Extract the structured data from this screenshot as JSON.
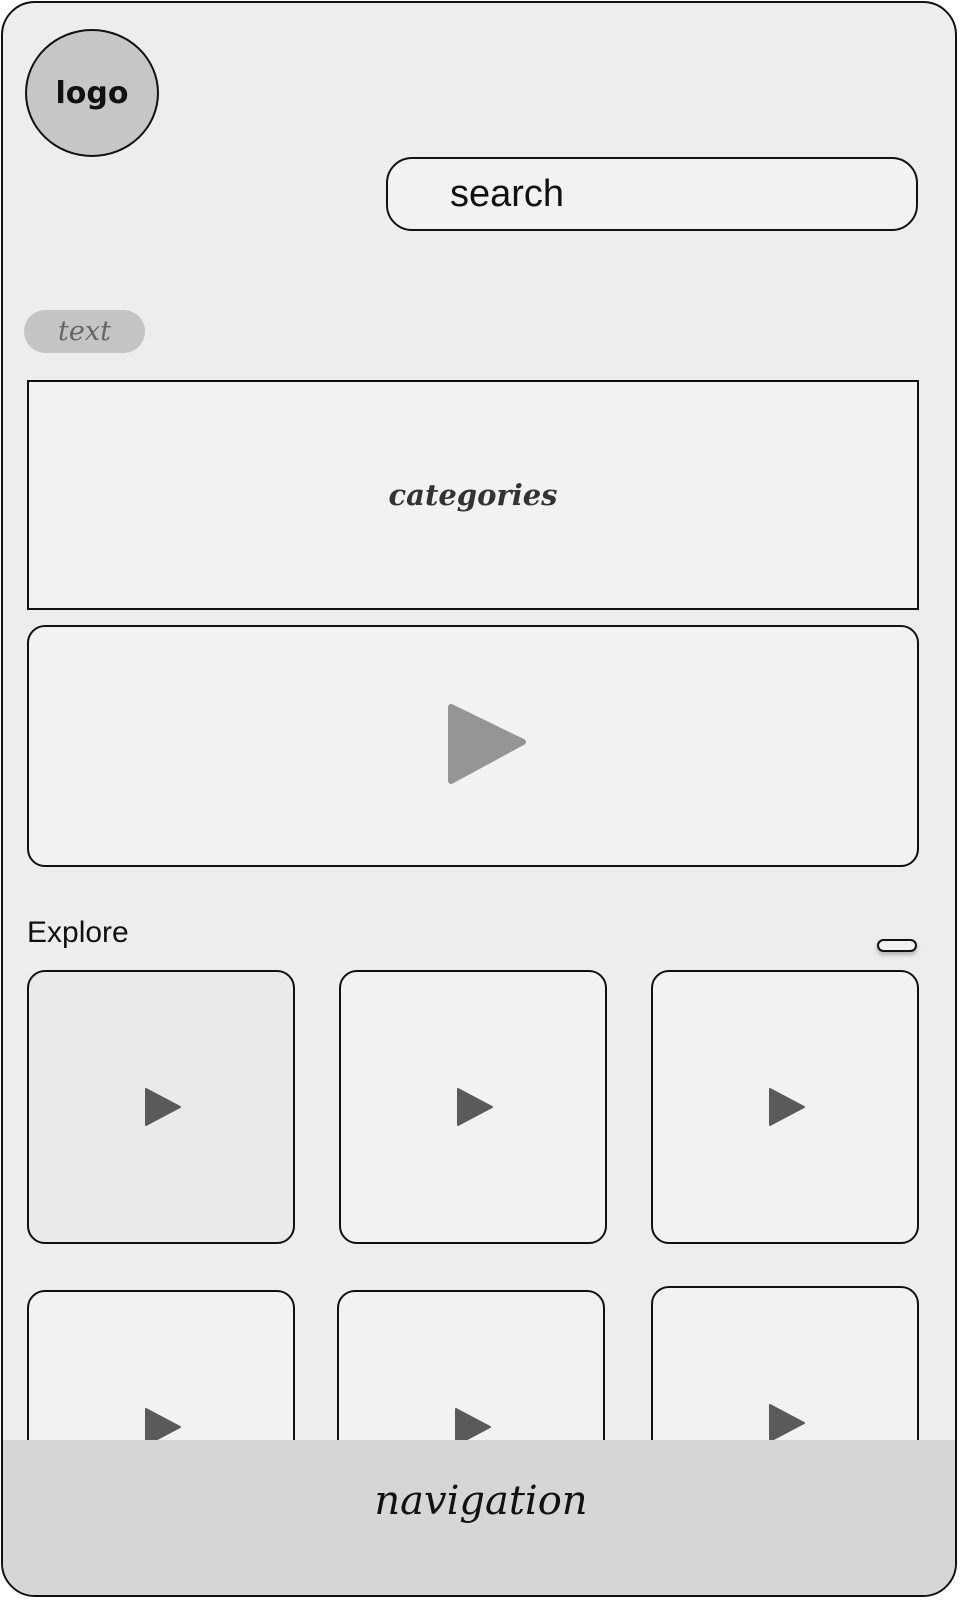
{
  "header": {
    "logo_label": "logo",
    "search_label": "search"
  },
  "chip_label": "text",
  "categories_label": "categories",
  "featured_video": {
    "icon": "play-icon",
    "icon_color": "#959595"
  },
  "explore": {
    "title": "Explore",
    "tiles": [
      {
        "icon": "play-icon"
      },
      {
        "icon": "play-icon"
      },
      {
        "icon": "play-icon"
      },
      {
        "icon": "play-icon"
      },
      {
        "icon": "play-icon"
      },
      {
        "icon": "play-icon"
      }
    ],
    "tile_icon_color": "#5a5a5a"
  },
  "navigation_label": "navigation",
  "colors": {
    "background": "#ededed",
    "panel": "#f3f2f3",
    "logo_fill": "#c6c6c6",
    "chip_fill": "#c4c4c4",
    "nav_fill": "#d6d6d6",
    "border": "#111111"
  }
}
